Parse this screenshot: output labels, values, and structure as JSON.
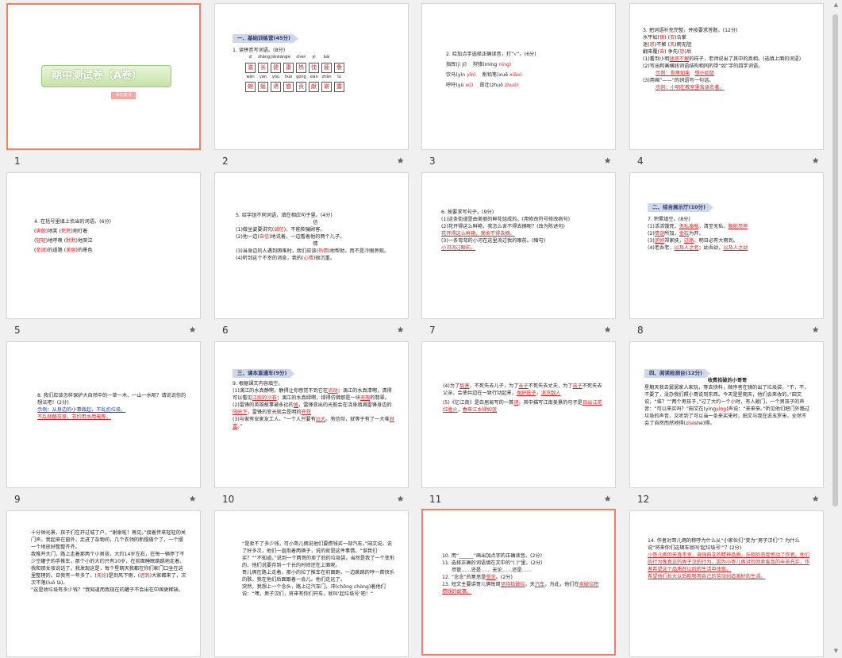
{
  "slides": [
    {
      "num": "1",
      "title": "期中测试卷（A卷）",
      "subtitle": "·单元复习·"
    },
    {
      "num": "2",
      "banner": "一、基础训练营(45分)",
      "q1": "1. 读拼音写词语。(8分)",
      "py1": [
        "zī",
        "zhǎng",
        "jiǎnkāng",
        "rè",
        "chén",
        "yì",
        "bài"
      ],
      "row1": [
        "滋",
        "长",
        "健",
        "康",
        "热",
        "忱",
        "疲",
        "惫"
      ],
      "py2": [
        "wān",
        "yán",
        "yòu",
        "huò",
        "gòng",
        "xiàn",
        "zhǎn",
        "lù"
      ],
      "row2": [
        "蜿",
        "蜒",
        "诱",
        "惑",
        "贡",
        "献",
        "崭",
        "露"
      ]
    },
    {
      "num": "3",
      "q": "2. 给加点字选择正确读音，打“√”。(6分)",
      "r1a": "指挥(",
      "r1b": "jǐ",
      "r1c": "jí)",
      "r1d": "狩猎(míng",
      "r1e": "níng)",
      "r2a": "饮马(yìn",
      "r2b": "yǐn)",
      "r2c": "削铅笔(xuē",
      "r2d": "xiāo)",
      "r3a": "呼吁(yù",
      "r3b": "xū)",
      "r3c": "茁壮(zhuō",
      "r3d": "zhuó)"
    },
    {
      "num": "4",
      "q": "3. 把词语补充完整，并按要求答题。(12分)",
      "a1": "水平如(",
      "a1r": "镜",
      "a1b": ")",
      "a1c": "(",
      "a1d": "百",
      "a1e": ")合掌",
      "a2": "迷(",
      "a2r": "惑",
      "a2b": ")不解",
      "a2c": "(",
      "a2d": "风",
      "a2e": ")雨无阻",
      "a3": "翻来覆(",
      "a3r": "去",
      "a3b": ")",
      "a3c": "争先(",
      "a3d": "恐",
      "a3e": ")后",
      "s1": "(1)看到小明",
      "s1r": "迷惑不解",
      "s1b": "的样子，老师说出了其中的真相。(选填上面的词语)",
      "s2": "(2)写出和画横线词语结构相同的带“如”字的四字词语。",
      "s2a": "示例：骨瘦如柴",
      "s2b": "想小如鼠",
      "s3": "(3)用画“——”的词语写一句话。",
      "s3a": "示例：小明在教室里苦读名著。"
    },
    {
      "num": "5",
      "q": "4. 在括号里填上恰当的词语。(6分)",
      "l1": [
        "(",
        "爽朗",
        ")地笑 (",
        "死死",
        ")地盯着"
      ],
      "l2": [
        "(",
        "轻轻",
        ")地呼唤 (",
        "默默",
        ")地哭泣"
      ],
      "l3": [
        "(",
        "宽阔",
        ")的道路 (",
        "美丽",
        ")的景色"
      ]
    },
    {
      "num": "6",
      "q": "5. 给字组不同词语，填在相应句子里。(4分)",
      "c1": "信",
      "s1": "(1)做坐姿要讲究(",
      "s1r": "诚信",
      "s1b": ")，不能欺骗顾客。",
      "s2": "(2)他一边(",
      "s2r": "自信",
      "s2b": ")地说着，一边看着他的两个儿子。",
      "c2": "情",
      "s3": "(3)当身边的人遇到困难时，我们应该(",
      "s3r": "热情",
      "s3b": ")地帮助，而不是冷眼旁观。",
      "s4": "(4)听到这个不幸的消息，我的(",
      "s4r": "心情",
      "s4b": ")很沉重。"
    },
    {
      "num": "7",
      "q": "6. 按要求写句子。(9分)",
      "s1": "(1)这条街道是由美丽的鲜花组成的。(用修改符号修改病句)",
      "s2": "(2)花开得这么鲜艳，我怎么舍不得去摘呢？(改为陈述句)",
      "s2a": "花开得这么鲜艳，我舍不得去摘。",
      "s3": "(3)一条弯弯的小河在这里流过我的眼前。(缩句)",
      "s3a": "小河流过眼前。"
    },
    {
      "num": "8",
      "banner": "二、综合展示厅(10分)",
      "q": "7. 积累填空。(8分)",
      "s1": "(1)活活饿死，",
      "s1r": "无私奉献",
      "s1b": "，清至无私，",
      "s1c": "鞠躬尽瘁",
      "s2": "(2)",
      "s2r": "情谊",
      "s2b": "所加，",
      "s2c": "金石",
      "s2d": "为开。",
      "s3": "(3)",
      "s3r": "逆好",
      "s3b": "郑家抚，",
      "s3c": "过路",
      "s3d": "，明日必有大雨到。",
      "s4": "(4)老吾老，",
      "s4r": "以及人之老",
      "s4b": "；幼吾幼，",
      "s4c": "以及人之幼"
    },
    {
      "num": "9",
      "q": "8. 我们应该怎样保护大自然中的一草一木、一山一水呢？请说说你的想法吧！(2分)",
      "a1": "示例：从身边的小事做起，不乱扔垃圾，",
      "a2": "不乱践踏花草，节约用水用电等。"
    },
    {
      "num": "10",
      "banner": "三、课本直通车(9分)",
      "q": "9. 根据课文内容填空。",
      "s1": "(1)漓江的水真静啊，静得让你感觉不到它在",
      "s1r": "流动",
      "s1b": "；漓江的水真清啊，清得可以看见",
      "s1c": "江底的沙石",
      "s1d": "；漓江的水真绿啊，绿得仿佛那是一块",
      "s1e": "无瑕",
      "s1f": "的翡翠。",
      "s2": "(2)雷锋的英雄故事被永远的",
      "s2r": "留",
      "s2b": "，雷锋变出的光能会在浇身填满雷锋身边的",
      "s2c": "阳光下",
      "s2d": "，雷锋的变光就会是明的",
      "s2e": "开花",
      "s3": "(3)与家有安家友工人。“一个人只要有",
      "s3r": "远大",
      "s3b": "。有信仰，就等于有了一大堆",
      "s3c": "财富",
      "s3d": "。”"
    },
    {
      "num": "11",
      "s1": "(4)为了",
      "s1r": "敌害",
      "s1b": "，不死失去儿子，为了",
      "s1c": "亲子",
      "s1d": "不死失去丈夫，为了",
      "s1e": "孩子",
      "s1f": "不死失去父亲，会使井边在一致行动起来，",
      "s1g": "保护孩子",
      "s1h": "，",
      "s1i": "消灭敌人",
      "s2": "(5)《忆江南》是白居易写的一首",
      "s2r": "词",
      "s2b": "，其中描写江南美景的句子是",
      "s2c": "日出江花红胜火",
      "s2d": "，",
      "s2e": "春来江水绿如蓝"
    },
    {
      "num": "12",
      "banner": "四、阅读检测台(12分)",
      "title": "收费拾破的小哥哥",
      "p1": "星期天我去舅舅家人家玩，等去快料，顺序者在镜的出了垃圾袋，“不，不，不要了，没办我们照小哥说到东西。今天是星期天，他们会来收的。”田文说，“谁？”“两个男孩子，”过了大约一个小时，有人敲门，一个男孩子的声音：“可以来买吗？”田文在(yìng",
      "p1r": "yìng",
      "p1b": ")声说：“来来来。”听见他们把门外路过垃圾的声音，又听到了可以当一条来买来时，田文与我在说玉罗宋，全然不会了自然而然地得(",
      "p1c": "zhé",
      "p1d": "shé)得。"
    },
    {
      "num": "13",
      "p1": "十分钟光景，孩子们在开过城了户，“谢谢啦！再见。”接着传来轻轻的关门声，我起来在窗外，走进了杂物间，几个衣领的新摆做个了，一个摆一个地放好整整齐齐。",
      "p2": "我推开大门，路上走着那两个小男孩，大约14岁左右，在每一辆停了不少空罐子的手推车，那个小的大约只有10岁，在前面睡眠跳跳地走着，我和那女孩说话了。我发现这是，每个星期天我都在你们家门口坐在这里整理的。日我有一年多了。(",
      "p2r": "无论",
      "p2b": ")是到风下雨，(",
      "p2c": "迟到",
      "p2d": ")大家都来了，次次不落(luò là)。",
      "p3": "“这是收垃圾有多少钱？”我知道而我现在的罐子不会出在中国更稀缺。"
    },
    {
      "num": "14",
      "p1": "“是卖不了多少钱，可小哥儿俩说他们要攒钱买一部汽车。”田文说。说了好多次，他们一直抱着两辆子，说的就是这件事情。“谁我们买？”“不知道。”说到一个两哥的卖了旧的垃圾袋，当然是我了一个变形的，他们说要存到一个长的时间还在上面呢。",
      "p2": "哥儿俩在路上走着，那小的拉了推车在前面跑，一边跳跳的哼一首快乐的歌。我在他们后面跟着一会儿。他们走远了。",
      "p3": "突然，我想上一个念头，路上过汽车门，冲(chōng chòng)着他们说：“嘿，男子汉们，将来有你们开车，就叫‘起垃圾号’吧！”"
    },
    {
      "num": "15",
      "q10": "10. 用“______”画出加点字的正确读音。(2分)",
      "q11": "11. 选择正确的词语填在文中的“(  )”里。(2分)",
      "q11a": "尽管……还是……   无论……还是……",
      "q12": "12. “念念”的意思是",
      "q12r": "想念",
      "q12b": "。(2分)",
      "q13": "13. 短文主要讲哥儿俩每周",
      "q13r": "坚持拾破烂",
      "q13b": "，天",
      "q13c": "汽车",
      "q13d": "，为此，他们在",
      "q13e": "卖破烂积攒钱的故事。"
    },
    {
      "num": "16",
      "q": "14. 作者对哥儿俩的称呼为什么从“小家伙们”变为“男子汉们”？为什么说“将来你们这辆车就叫‘起垃圾号’”？(2分)",
      "a1": "小哥儿俩的天真不幸，自强自立的精神品质，乐观的态度感动了作者。他们的行为像真正的男子汉的行为。因为小哥儿俩对捡回卖废品的辛苦充实，作者希望这个品质在以后的生活中体现。",
      "a2": "希望他们长大以后能够用自己的劳动创造美好的生活。"
    }
  ]
}
